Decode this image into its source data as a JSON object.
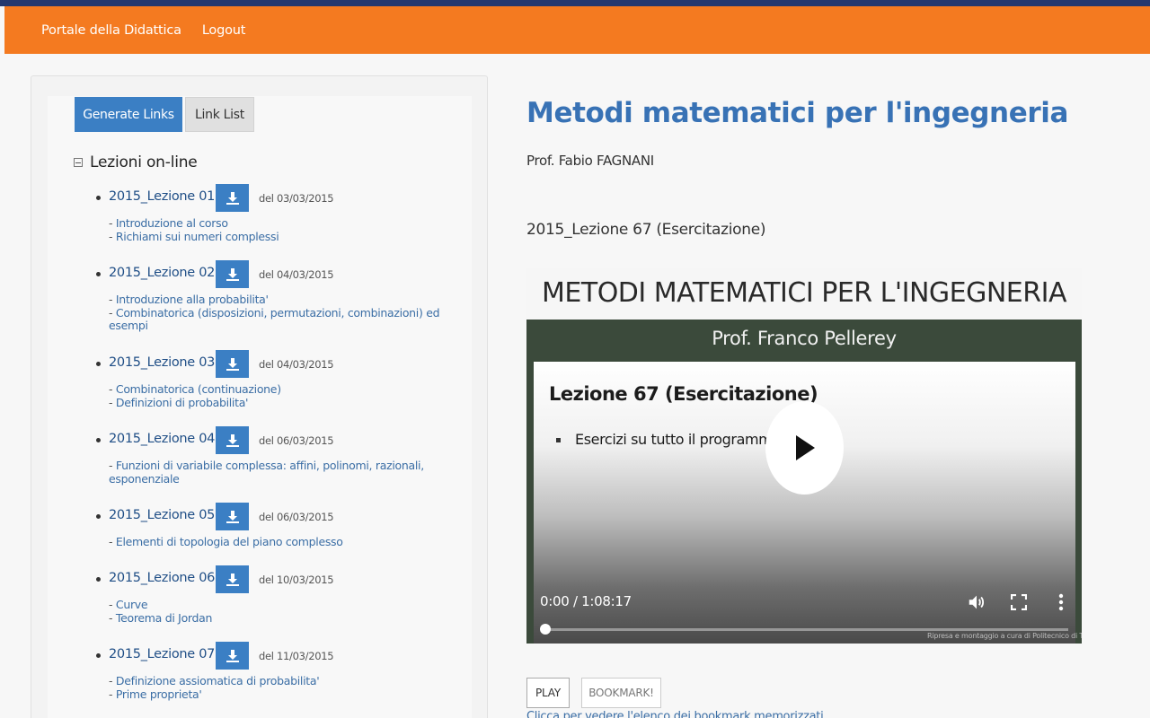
{
  "nav": {
    "portal_label": "Portale della Didattica",
    "logout_label": "Logout"
  },
  "sidebar": {
    "generate_label": "Generate Links",
    "linklist_label": "Link List",
    "tree_label": "Lezioni on-line",
    "lessons": [
      {
        "title": "2015_Lezione 01",
        "date": "del 03/03/2015",
        "topics": [
          "Introduzione al corso",
          "Richiami sui numeri complessi"
        ]
      },
      {
        "title": "2015_Lezione 02",
        "date": "del 04/03/2015",
        "topics": [
          "Introduzione alla probabilita'",
          "Combinatorica (disposizioni, permutazioni, combinazioni) ed esempi"
        ]
      },
      {
        "title": "2015_Lezione 03",
        "date": "del 04/03/2015",
        "topics": [
          "Combinatorica (continuazione)",
          "Definizioni di probabilita'"
        ]
      },
      {
        "title": "2015_Lezione 04",
        "date": "del 06/03/2015",
        "topics": [
          "Funzioni di variabile complessa: affini, polinomi, razionali, esponenziale"
        ]
      },
      {
        "title": "2015_Lezione 05",
        "date": "del 06/03/2015",
        "topics": [
          "Elementi di topologia del piano complesso"
        ]
      },
      {
        "title": "2015_Lezione 06",
        "date": "del 10/03/2015",
        "topics": [
          "Curve",
          "Teorema di Jordan"
        ]
      },
      {
        "title": "2015_Lezione 07",
        "date": "del 11/03/2015",
        "topics": [
          "Definizione assiomatica di probabilita'",
          "Prime proprieta'"
        ]
      }
    ]
  },
  "main": {
    "course_title": "Metodi matematici per l'ingegneria",
    "professor": "Prof. Fabio FAGNANI",
    "lesson_name": "2015_Lezione 67 (Esercitazione)",
    "video": {
      "slide_title": "METODI MATEMATICI PER L'INGEGNERIA",
      "slide_professor": "Prof. Franco Pellerey",
      "slide_lesson": "Lezione 67 (Esercitazione)",
      "slide_bullet": "Esercizi su tutto il programma",
      "time_display": "0:00 / 1:08:17",
      "credit": "Ripresa e montaggio a cura di Politecnico di Torino",
      "progress": 0
    },
    "play_label": "PLAY",
    "bookmark_label": "BOOKMARK!",
    "bookmark_link": "Clicca per vedere l'elenco dei bookmark memorizzati"
  },
  "colors": {
    "nav_orange": "#f47a20",
    "top_strip": "#24386e",
    "primary_blue": "#3b7fc4",
    "title_blue": "#3872b5",
    "link_blue": "#3b6ea5"
  }
}
